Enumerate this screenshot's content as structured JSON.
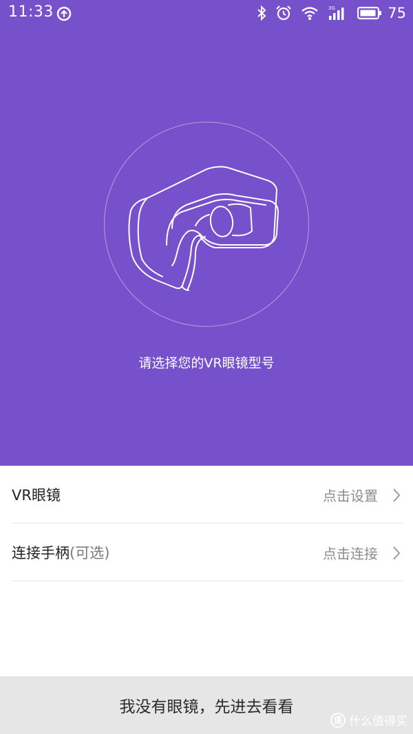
{
  "status_bar": {
    "time": "11:33",
    "network": "3G",
    "battery": "75"
  },
  "hero": {
    "prompt": "请选择您的VR眼镜型号",
    "background_color": "#7750cb",
    "illustration": "vr-headset-icon"
  },
  "list": {
    "items": [
      {
        "title": "VR眼镜",
        "note": "",
        "action": "点击设置"
      },
      {
        "title": "连接手柄",
        "note": "(可选)",
        "action": "点击连接"
      }
    ]
  },
  "bottom": {
    "button_label": "我没有眼镜，先进去看看"
  },
  "watermark": {
    "logo": "值",
    "text": "什么值得买"
  }
}
